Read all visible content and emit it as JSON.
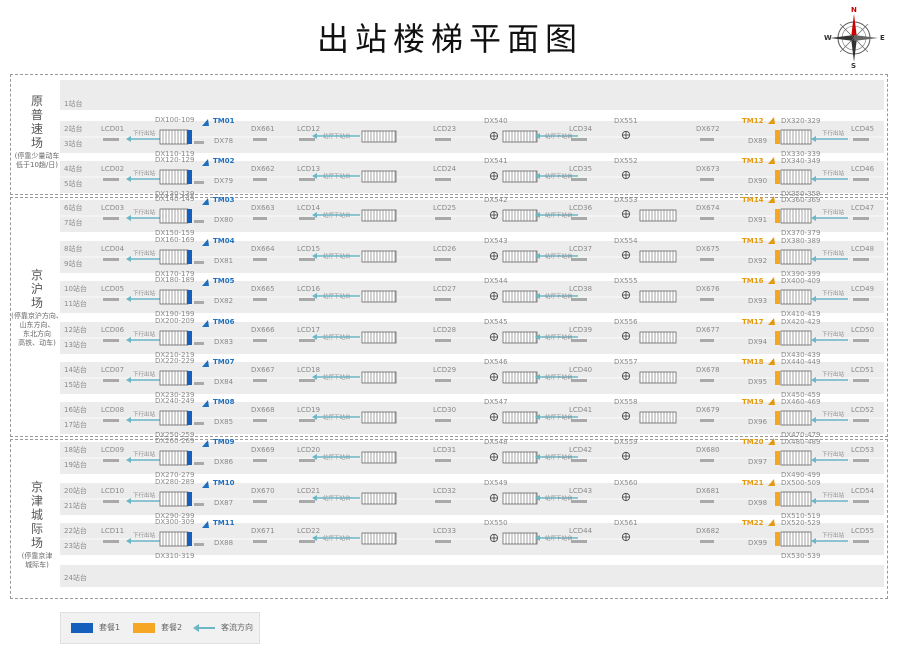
{
  "title": "出站楼梯平面图",
  "compass": {
    "n": "N",
    "s": "S",
    "w": "W",
    "e": "E"
  },
  "colors": {
    "set1": "#1560bd",
    "set2": "#f5a623",
    "flow": "#6bb7c6",
    "tmLeft": "#1f6fc0",
    "tmRight": "#e39a10",
    "band": "#ececec",
    "text": "#8a8a8a"
  },
  "halls": [
    {
      "name": "原\n普\n速\n场",
      "note": "(停靠少量动车\n低于10趟/日)"
    },
    {
      "name": "京\n沪\n场",
      "note": "(停靠京沪方向、\n山东方向、\n东北方向\n高铁、动车)"
    },
    {
      "name": "京\n津\n城\n际\n场",
      "note": "(停靠京津\n城际车)"
    }
  ],
  "platform_rows": [
    {
      "labels": [
        "1站台"
      ]
    },
    {
      "labels": [
        "2站台",
        "3站台"
      ],
      "lcd": [
        "LCD01",
        "LCD12",
        "LCD23",
        "LCD34",
        "LCD45"
      ],
      "dxTop": "DX100-109",
      "dxBot": "DX110-119",
      "tm": "TM01",
      "dxL": "DX78",
      "dxs": [
        "DX661",
        "DX540",
        "DX551",
        "DX672"
      ],
      "tmR": "TM12",
      "dxRTop": "DX320-329",
      "dxR": "DX89",
      "dxRBot": "DX330-339",
      "down": "站厅下站台",
      "exitL": "下行出站",
      "exitR": "下行出站"
    },
    {
      "labels": [
        "4站台",
        "5站台"
      ],
      "lcd": [
        "LCD02",
        "LCD13",
        "LCD24",
        "LCD35",
        "LCD46"
      ],
      "dxTop": "DX120-129",
      "dxBot": "DX130-139",
      "tm": "TM02",
      "dxL": "DX79",
      "dxs": [
        "DX662",
        "DX541",
        "DX552",
        "DX673"
      ],
      "tmR": "TM13",
      "dxRTop": "DX340-349",
      "dxR": "DX90",
      "dxRBot": "DX350-359",
      "down": "站厅下站台",
      "exitL": "下行出站",
      "exitR": "下行出站"
    },
    {
      "labels": [
        "6站台",
        "7站台"
      ],
      "lcd": [
        "LCD03",
        "LCD14",
        "LCD25",
        "LCD36",
        "LCD47"
      ],
      "dxTop": "DX140-149",
      "dxBot": "DX150-159",
      "tm": "TM03",
      "dxL": "DX80",
      "dxs": [
        "DX663",
        "DX542",
        "DX553",
        "DX674"
      ],
      "tmR": "TM14",
      "dxRTop": "DX360-369",
      "dxR": "DX91",
      "dxRBot": "DX370-379",
      "down": "站厅下站台",
      "exitL": "下行出站",
      "exitR": "下行出站"
    },
    {
      "labels": [
        "8站台",
        "9站台"
      ],
      "lcd": [
        "LCD04",
        "LCD15",
        "LCD26",
        "LCD37",
        "LCD48"
      ],
      "dxTop": "DX160-169",
      "dxBot": "DX170-179",
      "tm": "TM04",
      "dxL": "DX81",
      "dxs": [
        "DX664",
        "DX543",
        "DX554",
        "DX675"
      ],
      "tmR": "TM15",
      "dxRTop": "DX380-389",
      "dxR": "DX92",
      "dxRBot": "DX390-399",
      "down": "站厅下站台",
      "exitL": "下行出站",
      "exitR": "下行出站"
    },
    {
      "labels": [
        "10站台",
        "11站台"
      ],
      "lcd": [
        "LCD05",
        "LCD16",
        "LCD27",
        "LCD38",
        "LCD49"
      ],
      "dxTop": "DX180-189",
      "dxBot": "DX190-199",
      "tm": "TM05",
      "dxL": "DX82",
      "dxs": [
        "DX665",
        "DX544",
        "DX555",
        "DX676"
      ],
      "tmR": "TM16",
      "dxRTop": "DX400-409",
      "dxR": "DX93",
      "dxRBot": "DX410-419",
      "down": "站厅下站台",
      "exitL": "下行出站",
      "exitR": "下行出站"
    },
    {
      "labels": [
        "12站台",
        "13站台"
      ],
      "lcd": [
        "LCD06",
        "LCD17",
        "LCD28",
        "LCD39",
        "LCD50"
      ],
      "dxTop": "DX200-209",
      "dxBot": "DX210-219",
      "tm": "TM06",
      "dxL": "DX83",
      "dxs": [
        "DX666",
        "DX545",
        "DX556",
        "DX677"
      ],
      "tmR": "TM17",
      "dxRTop": "DX420-429",
      "dxR": "DX94",
      "dxRBot": "DX430-439",
      "down": "站厅下站台",
      "exitL": "下行出站",
      "exitR": "下行出站"
    },
    {
      "labels": [
        "14站台",
        "15站台"
      ],
      "lcd": [
        "LCD07",
        "LCD18",
        "LCD29",
        "LCD40",
        "LCD51"
      ],
      "dxTop": "DX220-229",
      "dxBot": "DX230-239",
      "tm": "TM07",
      "dxL": "DX84",
      "dxs": [
        "DX667",
        "DX546",
        "DX557",
        "DX678"
      ],
      "tmR": "TM18",
      "dxRTop": "DX440-449",
      "dxR": "DX95",
      "dxRBot": "DX450-459",
      "down": "站厅下站台",
      "exitL": "下行出站",
      "exitR": "下行出站"
    },
    {
      "labels": [
        "16站台",
        "17站台"
      ],
      "lcd": [
        "LCD08",
        "LCD19",
        "LCD30",
        "LCD41",
        "LCD52"
      ],
      "dxTop": "DX240-249",
      "dxBot": "DX250-259",
      "tm": "TM08",
      "dxL": "DX85",
      "dxs": [
        "DX668",
        "DX547",
        "DX558",
        "DX679"
      ],
      "tmR": "TM19",
      "dxRTop": "DX460-469",
      "dxR": "DX96",
      "dxRBot": "DX470-479",
      "down": "站厅下站台",
      "exitL": "下行出站",
      "exitR": "下行出站"
    },
    {
      "labels": [
        "18站台",
        "19站台"
      ],
      "lcd": [
        "LCD09",
        "LCD20",
        "LCD31",
        "LCD42",
        "LCD53"
      ],
      "dxTop": "DX260-269",
      "dxBot": "DX270-279",
      "tm": "TM09",
      "dxL": "DX86",
      "dxs": [
        "DX669",
        "DX548",
        "DX559",
        "DX680"
      ],
      "tmR": "TM20",
      "dxRTop": "DX480-489",
      "dxR": "DX97",
      "dxRBot": "DX490-499",
      "down": "站厅下站台",
      "exitL": "下行出站",
      "exitR": "下行出站"
    },
    {
      "labels": [
        "20站台",
        "21站台"
      ],
      "lcd": [
        "LCD10",
        "LCD21",
        "LCD32",
        "LCD43",
        "LCD54"
      ],
      "dxTop": "DX280-289",
      "dxBot": "DX290-299",
      "tm": "TM10",
      "dxL": "DX87",
      "dxs": [
        "DX670",
        "DX549",
        "DX560",
        "DX681"
      ],
      "tmR": "TM21",
      "dxRTop": "DX500-509",
      "dxR": "DX98",
      "dxRBot": "DX510-519",
      "down": "站厅下站台",
      "exitL": "下行出站",
      "exitR": "下行出站"
    },
    {
      "labels": [
        "22站台",
        "23站台"
      ],
      "lcd": [
        "LCD11",
        "LCD22",
        "LCD33",
        "LCD44",
        "LCD55"
      ],
      "dxTop": "DX300-309",
      "dxBot": "DX310-319",
      "tm": "TM11",
      "dxL": "DX88",
      "dxs": [
        "DX671",
        "DX550",
        "DX561",
        "DX682"
      ],
      "tmR": "TM22",
      "dxRTop": "DX520-529",
      "dxR": "DX99",
      "dxRBot": "DX530-539",
      "down": "站厅下站台",
      "exitL": "下行出站",
      "exitR": "下行出站"
    },
    {
      "labels": [
        "24站台"
      ]
    }
  ],
  "legend": {
    "set1": "套餐1",
    "set2": "套餐2",
    "flow": "客流方向"
  }
}
